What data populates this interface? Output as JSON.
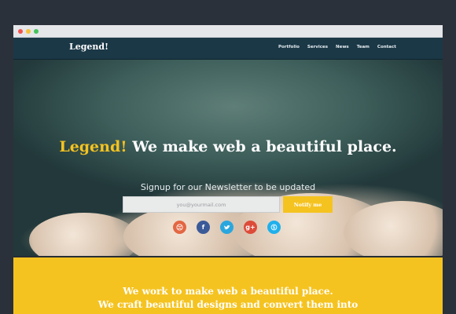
{
  "window": {
    "controls": [
      "close",
      "minimize",
      "maximize"
    ]
  },
  "nav": {
    "logo": "Legend!",
    "links": [
      "Portfolio",
      "Services",
      "News",
      "Team",
      "Contact"
    ]
  },
  "hero": {
    "brand": "Legend!",
    "headline": " We make web a beautiful place.",
    "signup_text": "Signup for our Newsletter to be updated",
    "email_placeholder": "you@yourmail.com",
    "notify_label": "Notify me",
    "social_icons": [
      "dribbble-icon",
      "facebook-icon",
      "twitter-icon",
      "google-plus-icon",
      "skype-icon"
    ]
  },
  "about": {
    "line1": "We work to make web a beautiful place.",
    "line2": "We craft beautiful designs and convert them into"
  },
  "colors": {
    "accent": "#f5c320",
    "nav_bg": "#1b3847",
    "page_bg": "#2b313a"
  }
}
